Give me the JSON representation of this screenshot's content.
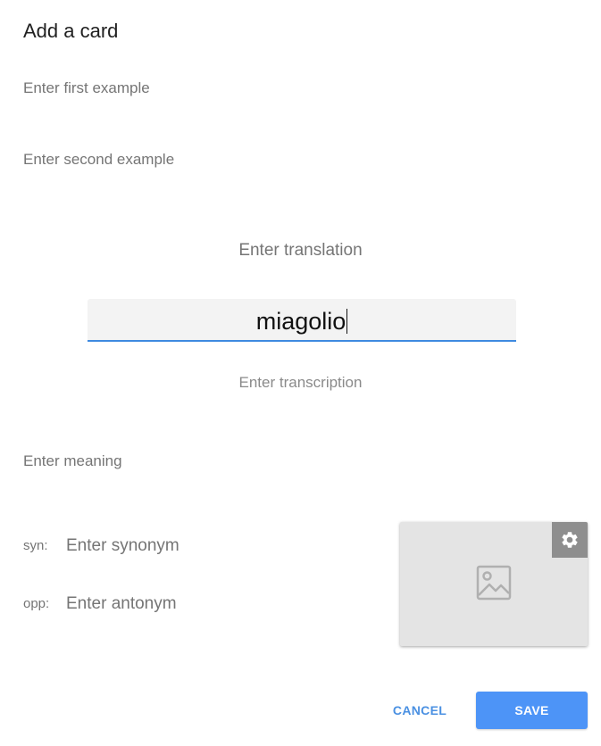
{
  "dialog": {
    "title": "Add a card"
  },
  "examples": {
    "first_placeholder": "Enter first example",
    "second_placeholder": "Enter second example"
  },
  "translation": {
    "placeholder": "Enter translation"
  },
  "word": {
    "value": "miagolio"
  },
  "transcription": {
    "placeholder": "Enter transcription"
  },
  "meaning": {
    "placeholder": "Enter meaning"
  },
  "synonym": {
    "label": "syn:",
    "placeholder": "Enter synonym"
  },
  "antonym": {
    "label": "opp:",
    "placeholder": "Enter antonym"
  },
  "image": {
    "icon": "image-placeholder-icon",
    "settings_icon": "gear-icon"
  },
  "actions": {
    "cancel_label": "CANCEL",
    "save_label": "SAVE"
  },
  "colors": {
    "accent": "#4d94f7",
    "underline": "#3f8ae0",
    "placeholder": "#757575"
  }
}
